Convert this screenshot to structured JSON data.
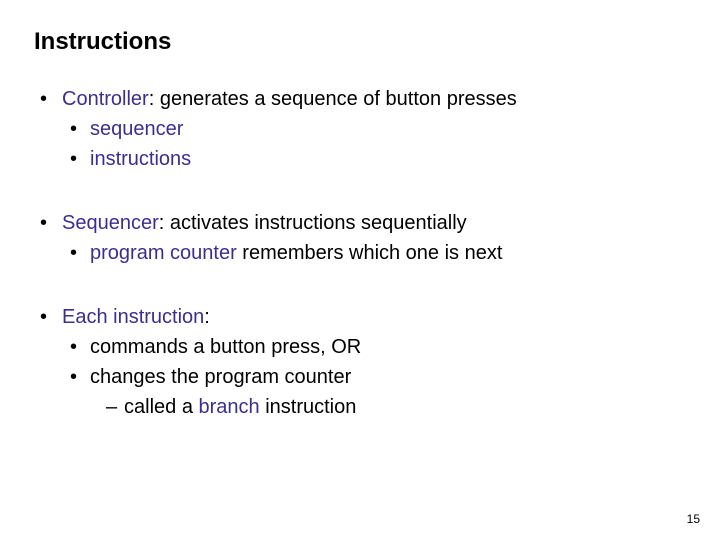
{
  "title": "Instructions",
  "blocks": [
    {
      "l1_pre": "Controller",
      "l1_post": ": generates a sequence of button presses",
      "children": [
        {
          "type": "l2",
          "accent": "sequencer",
          "post": ""
        },
        {
          "type": "l2",
          "accent": "instructions",
          "post": ""
        }
      ]
    },
    {
      "l1_pre": "Sequencer",
      "l1_post": ": activates instructions sequentially",
      "children": [
        {
          "type": "l2",
          "accent": "program counter",
          "post": " remembers which one is next"
        }
      ]
    },
    {
      "l1_pre": "Each instruction",
      "l1_post": ":",
      "children": [
        {
          "type": "l2",
          "plain": "commands a button press, OR"
        },
        {
          "type": "l2",
          "plain": "changes the program counter"
        },
        {
          "type": "l3",
          "pre": "called a ",
          "accent": "branch",
          "post": " instruction"
        }
      ]
    }
  ],
  "page_number": "15",
  "accent_color": "#3a2f8f"
}
